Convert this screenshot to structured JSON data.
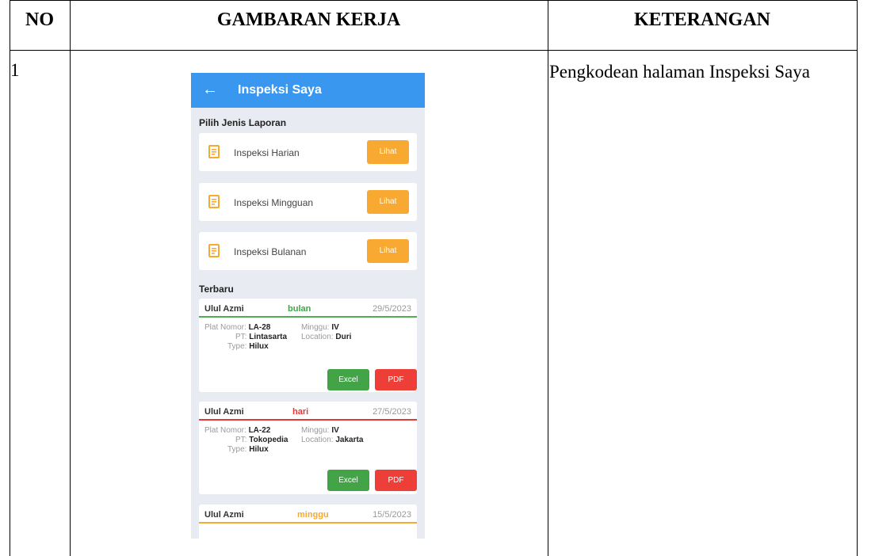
{
  "table": {
    "headers": [
      "NO",
      "GAMBARAN KERJA",
      "KETERANGAN"
    ],
    "row": {
      "no": "1",
      "keterangan": "Pengkodean halaman Inspeksi Saya"
    }
  },
  "app": {
    "title": "Inspeksi Saya",
    "back_icon": "arrow-left-icon",
    "section_types": "Pilih Jenis Laporan",
    "types": [
      {
        "label": "Inspeksi Harian",
        "button": "Lihat"
      },
      {
        "label": "Inspeksi Mingguan",
        "button": "Lihat"
      },
      {
        "label": "Inspeksi Bulanan",
        "button": "Lihat"
      }
    ],
    "section_recent": "Terbaru",
    "reports": [
      {
        "name": "Ulul Azmi",
        "period": "bulan",
        "period_color": "#43a447",
        "date": "29/5/2023",
        "plat_label": "Plat Nomor:",
        "plat": "LA-28",
        "minggu_label": "Minggu:",
        "minggu": "IV",
        "pt_label": "PT:",
        "pt": "Lintasarta",
        "location_label": "Location:",
        "location": "Duri",
        "type_label": "Type:",
        "type": "Hilux",
        "excel": "Excel",
        "pdf": "PDF"
      },
      {
        "name": "Ulul Azmi",
        "period": "hari",
        "period_color": "#e53935",
        "date": "27/5/2023",
        "plat_label": "Plat Nomor:",
        "plat": "LA-22",
        "minggu_label": "Minggu:",
        "minggu": "IV",
        "pt_label": "PT:",
        "pt": "Tokopedia",
        "location_label": "Location:",
        "location": "Jakarta",
        "type_label": "Type:",
        "type": "Hilux",
        "excel": "Excel",
        "pdf": "PDF"
      },
      {
        "name": "Ulul Azmi",
        "period": "minggu",
        "period_color": "#f7a932",
        "date": "15/5/2023"
      }
    ],
    "colors": {
      "appbar": "#3a97f0",
      "lihat": "#f7a932",
      "excel": "#43a447",
      "pdf": "#ee3e38",
      "background": "#e9ebf2"
    }
  }
}
